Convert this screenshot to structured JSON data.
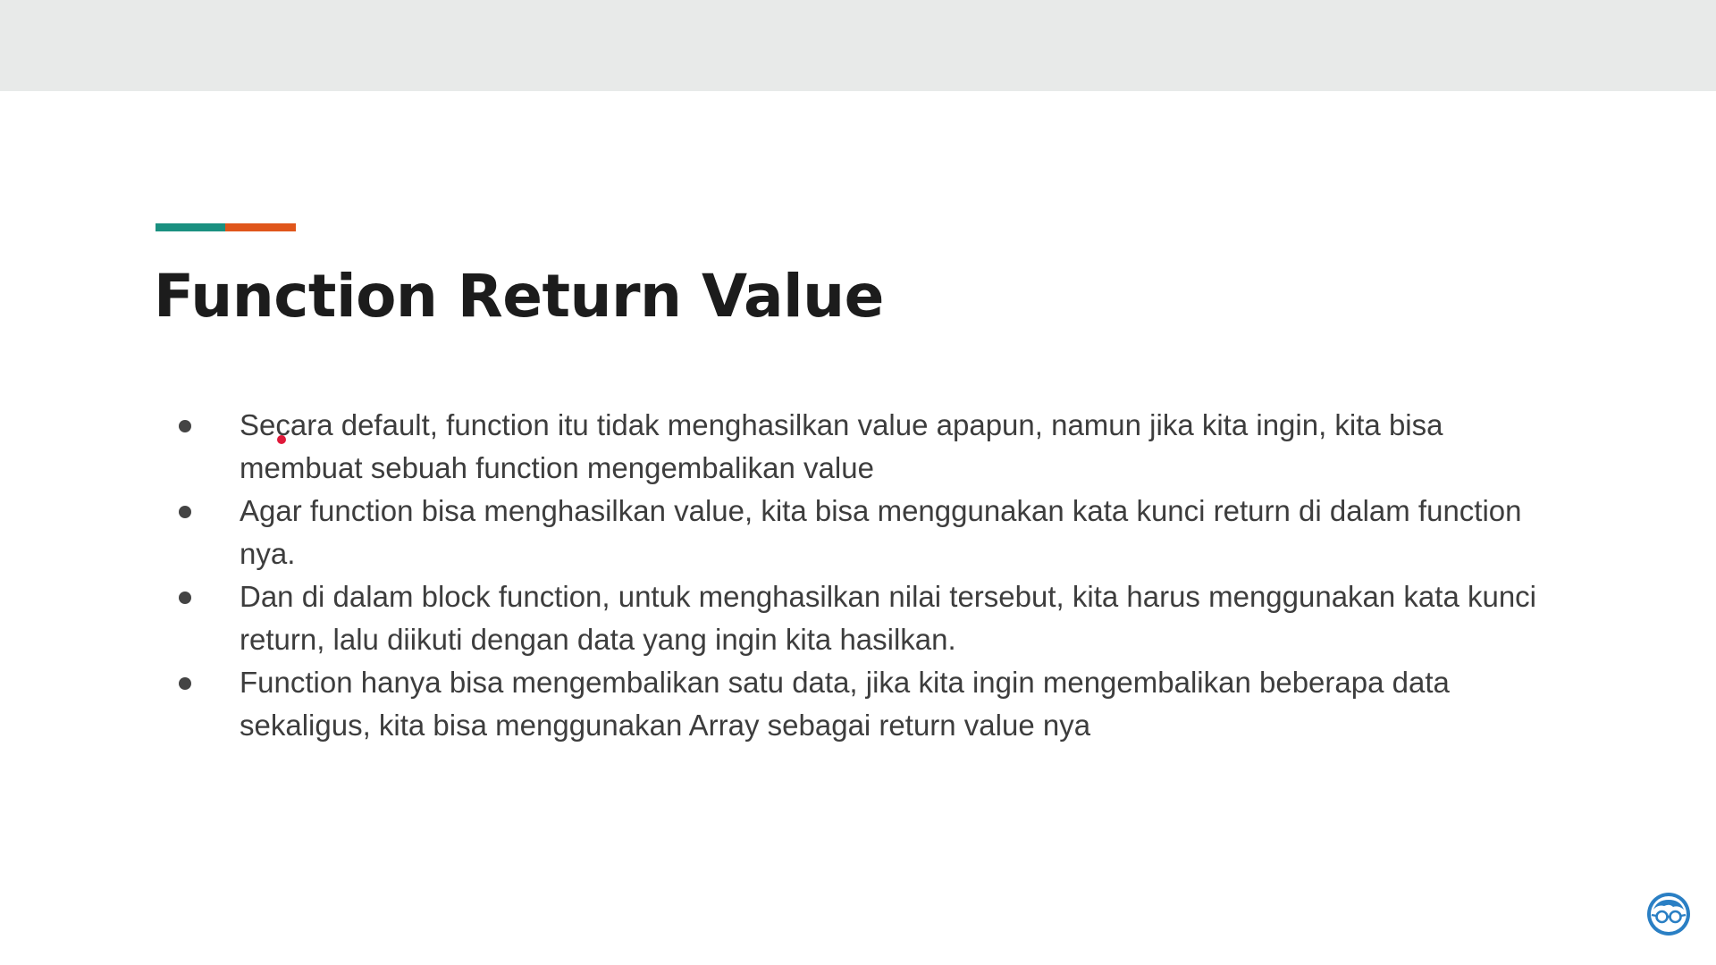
{
  "slide": {
    "title": "Function Return Value",
    "bullets": [
      "Secara default, function itu tidak menghasilkan value apapun, namun jika kita ingin, kita bisa membuat sebuah function mengembalikan value",
      "Agar function bisa menghasilkan value, kita bisa menggunakan kata kunci return di dalam function nya.",
      "Dan di dalam block function, untuk menghasilkan nilai tersebut, kita harus menggunakan kata kunci return, lalu diikuti dengan data yang ingin kita hasilkan.",
      "Function hanya bisa mengembalikan satu data, jika kita ingin mengembalikan beberapa data sekaligus, kita bisa menggunakan Array sebagai return value nya"
    ]
  },
  "colors": {
    "accent_teal": "#1a9080",
    "accent_orange": "#e0561b",
    "header_bar": "#e8eae9",
    "cursor": "#e0193a",
    "logo": "#2a7fc4"
  },
  "icons": {
    "bullet": "bullet-dot-icon",
    "cursor": "pointer-dot-icon",
    "logo": "glasses-face-logo-icon"
  }
}
